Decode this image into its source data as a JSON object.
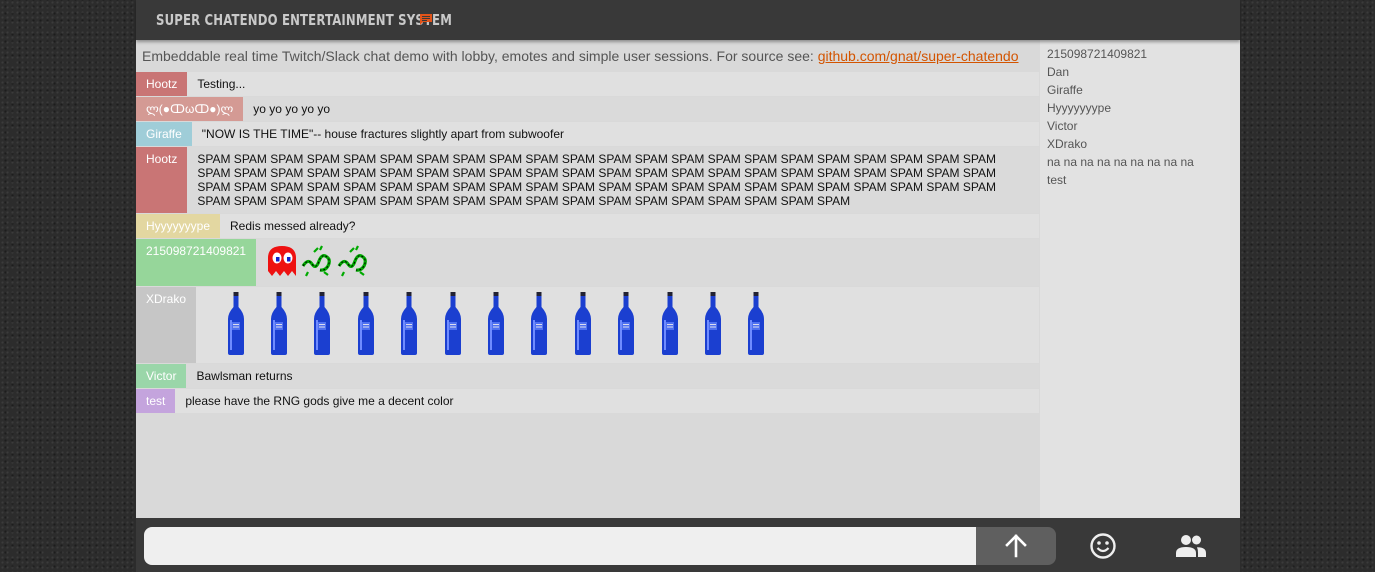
{
  "header": {
    "title": "SUPER CHATENDO ENTERTAINMENT SYSTEM",
    "accent": "#e2541a"
  },
  "intro": {
    "text": "Embeddable real time Twitch/Slack chat demo with lobby, emotes and simple user sessions. For source see: ",
    "link": "github.com/gnat/super-chatendo"
  },
  "messages": [
    {
      "nick": "Hootz",
      "color": "#c97575",
      "text": "Testing..."
    },
    {
      "nick": "ლ(●ↀωↀ●)ლ",
      "color": "#d49a94",
      "text": "yo yo yo yo yo"
    },
    {
      "nick": "Giraffe",
      "color": "#9fcdd8",
      "text": "\"NOW IS THE TIME\"-- house fractures slightly apart from subwoofer"
    },
    {
      "nick": "Hootz",
      "color": "#c97575",
      "text": "SPAM SPAM SPAM SPAM SPAM SPAM SPAM SPAM SPAM SPAM SPAM SPAM SPAM SPAM SPAM SPAM SPAM SPAM SPAM SPAM SPAM SPAM SPAM SPAM SPAM SPAM SPAM SPAM SPAM SPAM SPAM SPAM SPAM SPAM SPAM SPAM SPAM SPAM SPAM SPAM SPAM SPAM SPAM SPAM SPAM SPAM SPAM SPAM SPAM SPAM SPAM SPAM SPAM SPAM SPAM SPAM SPAM SPAM SPAM SPAM SPAM SPAM SPAM SPAM SPAM SPAM SPAM SPAM SPAM SPAM SPAM SPAM SPAM SPAM SPAM SPAM SPAM SPAM SPAM SPAM SPAM SPAM SPAM SPAM"
    },
    {
      "nick": "Hyyyyyyype",
      "color": "#e3d7a1",
      "text": "Redis messed already?"
    },
    {
      "nick": "215098721409821",
      "color": "#96d69a",
      "emotes": [
        "pacman-ghost",
        "razer-snake",
        "razer-snake"
      ]
    },
    {
      "nick": "XDrako",
      "color": "#c6c6c6",
      "bottles": 13
    },
    {
      "nick": "Victor",
      "color": "#9ad6a9",
      "text": "Bawlsman returns"
    },
    {
      "nick": "test",
      "color": "#c4a4dd",
      "text": "please have the RNG gods give me a decent color"
    }
  ],
  "users": [
    "215098721409821",
    "Dan",
    "Giraffe",
    "Hyyyyyyype",
    "Victor",
    "XDrako",
    "na na na na na na na na na",
    "test"
  ],
  "input": {
    "value": "",
    "placeholder": ""
  },
  "footer": {
    "send_icon": "arrow-up-icon",
    "emote_icon": "smiley-icon",
    "users_icon": "people-icon"
  }
}
